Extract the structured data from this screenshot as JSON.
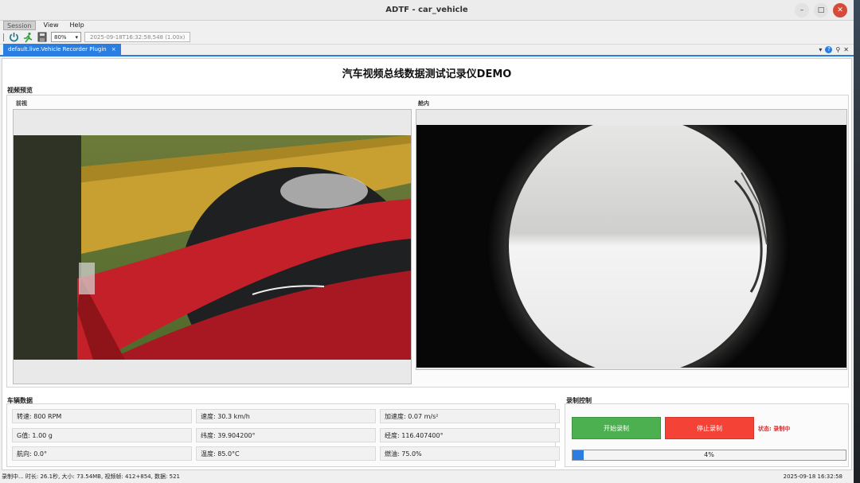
{
  "window": {
    "title": "ADTF - car_vehicle"
  },
  "menu": [
    "Session",
    "View",
    "Help"
  ],
  "toolbar": {
    "zoom": "80%",
    "time": "2025-09-18T16:32:58.548 (1.00x)"
  },
  "tab": {
    "label": "default.live.Vehicle Recorder Plugin",
    "close": "×"
  },
  "app": {
    "title": "汽车视频总线数据测试记录仪DEMO"
  },
  "video": {
    "section": "视频预览",
    "front_label": "前视",
    "cabin_label": "舱内"
  },
  "vehicle": {
    "section": "车辆数据",
    "rows": [
      [
        "转速: 800 RPM",
        "速度: 30.3 km/h",
        "加速度: 0.07 m/s²"
      ],
      [
        "G值: 1.00 g",
        "纬度: 39.904200°",
        "经度: 116.407400°"
      ],
      [
        "航向: 0.0°",
        "温度: 85.0°C",
        "燃油: 75.0%"
      ]
    ]
  },
  "recording": {
    "section": "录制控制",
    "start_label": "开始录制",
    "stop_label": "停止录制",
    "status": "状态: 录制中",
    "progress": 4,
    "progress_label": "4%"
  },
  "statusbar": {
    "left": "录制中... 时长: 26.1秒, 大小: 73.54MB, 视频帧: 412+854, 数据: 521",
    "right": "2025-09-18 16:32:58"
  },
  "colors": {
    "accent": "#2a7de1",
    "start": "#4caf50",
    "stop": "#f44336"
  }
}
